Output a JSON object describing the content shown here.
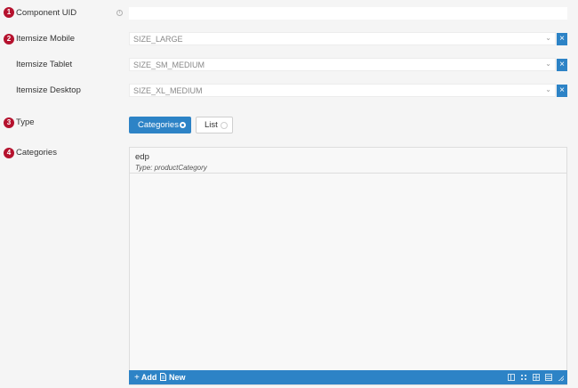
{
  "fields": {
    "component_uid": {
      "badge": "1",
      "label": "Component UID",
      "value": "",
      "info_icon": "info-icon"
    },
    "itemsize_mobile": {
      "badge": "2",
      "label": "Itemsize Mobile",
      "value": "SIZE_LARGE",
      "clear_glyph": "×"
    },
    "itemsize_tablet": {
      "label": "Itemsize Tablet",
      "value": "SIZE_SM_MEDIUM",
      "clear_glyph": "×"
    },
    "itemsize_desktop": {
      "label": "Itemsize Desktop",
      "value": "SIZE_XL_MEDIUM",
      "clear_glyph": "×"
    },
    "type": {
      "badge": "3",
      "label": "Type",
      "options": [
        {
          "label": "Categories",
          "selected": true
        },
        {
          "label": "List",
          "selected": false
        }
      ]
    },
    "categories": {
      "badge": "4",
      "label": "Categories",
      "items": [
        {
          "name": "edp",
          "type_text": "Type: productCategory"
        }
      ]
    }
  },
  "toolbar": {
    "add_label": "Add",
    "add_icon": "+",
    "new_label": "New",
    "new_icon": "document-icon",
    "view_icons": [
      "list-view-icon",
      "tree-view-icon",
      "grid-view-icon",
      "compact-view-icon",
      "resize-handle-icon"
    ]
  },
  "colors": {
    "accent": "#2d83c6",
    "badge": "#b5122e",
    "background": "#f5f5f5"
  }
}
